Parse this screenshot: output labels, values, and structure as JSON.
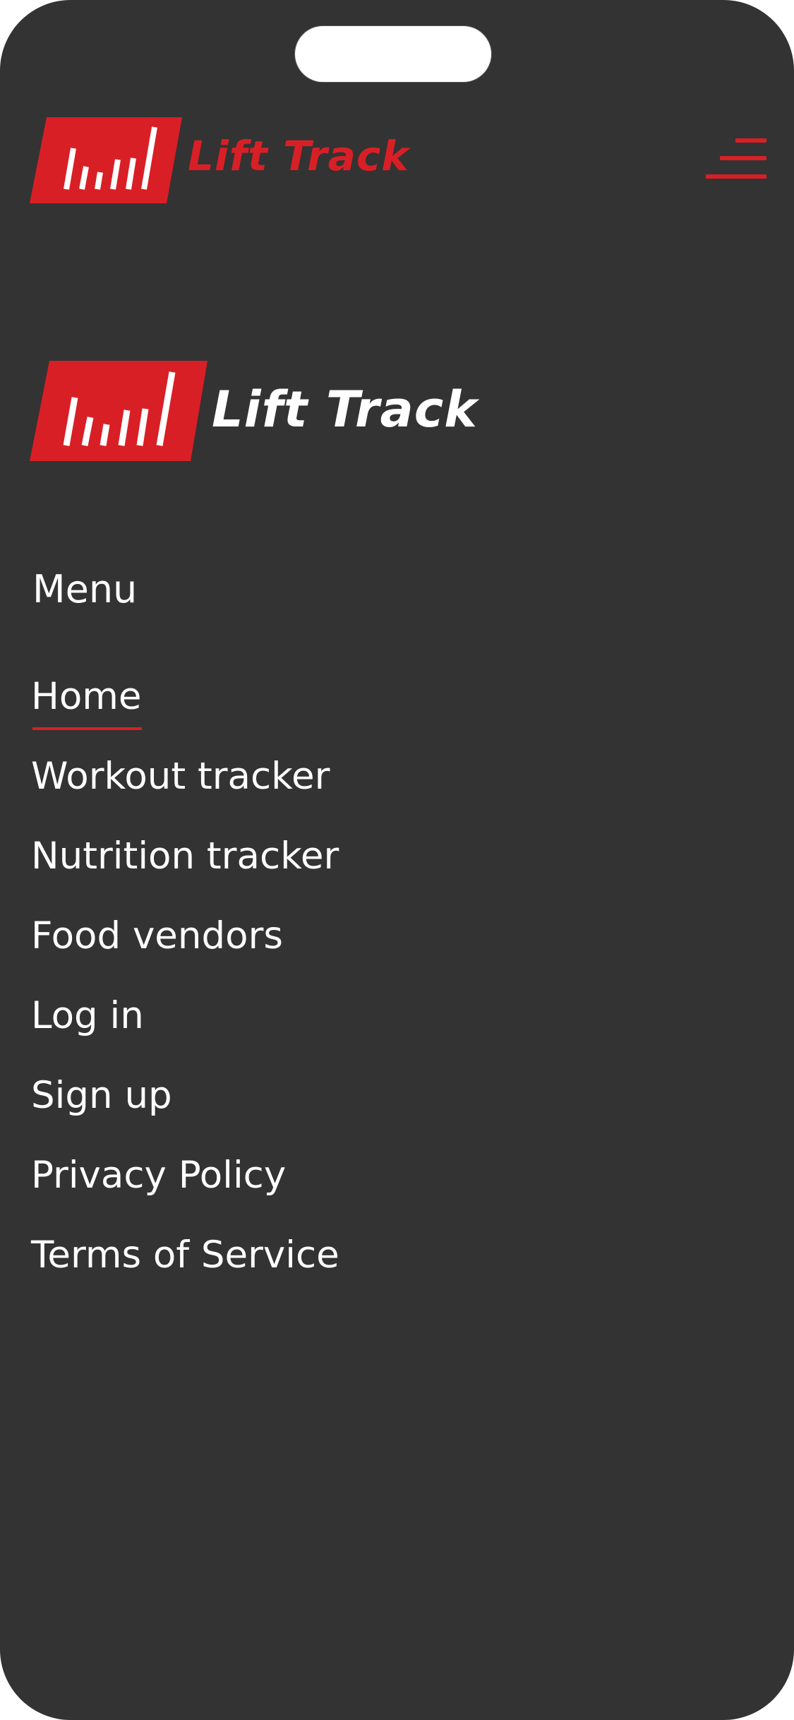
{
  "brand": {
    "name": "Lift Track",
    "accent_color": "#d91f26",
    "logo_icon": "bar-chart-logo-icon"
  },
  "header": {
    "menu_icon": "hamburger-menu-icon"
  },
  "drawer": {
    "heading": "Menu",
    "active_item": "Home",
    "items": [
      {
        "label": "Home"
      },
      {
        "label": "Workout tracker"
      },
      {
        "label": "Nutrition tracker"
      },
      {
        "label": "Food vendors"
      },
      {
        "label": "Log in"
      },
      {
        "label": "Sign up"
      },
      {
        "label": "Privacy Policy"
      },
      {
        "label": "Terms of Service"
      }
    ]
  }
}
